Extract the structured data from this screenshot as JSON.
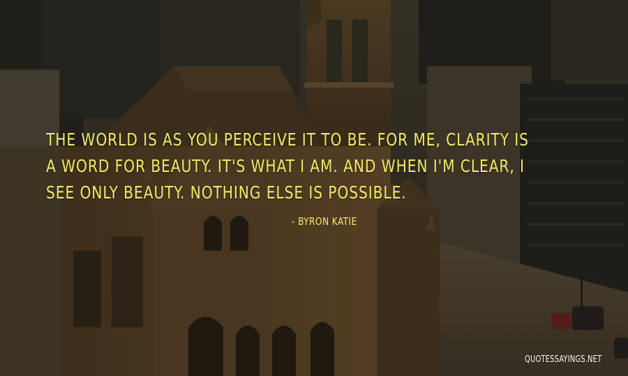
{
  "quote": {
    "text": "The world is as you perceive it to be. For me, clarity is a word for beauty. It's what I am. And when I'm clear, I see only beauty. Nothing else is possible.",
    "author": "- Byron Katie"
  },
  "watermark": "QUOTESSAYINGS.NET",
  "colors": {
    "quote_text": "#f2e96a",
    "watermark_text": "#ffffff"
  }
}
